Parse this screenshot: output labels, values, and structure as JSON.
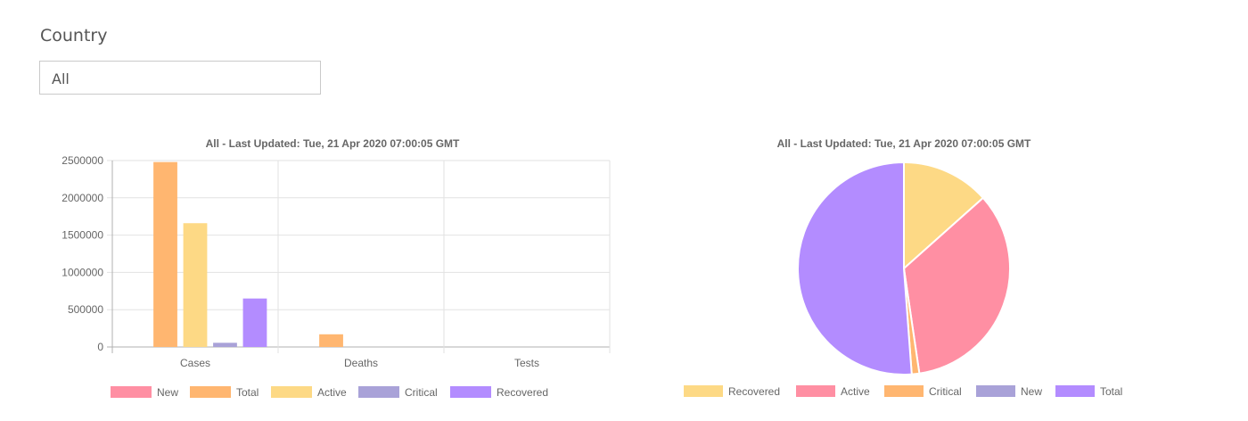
{
  "filter": {
    "label": "Country",
    "value": "All"
  },
  "chart_data": [
    {
      "type": "bar",
      "title": "All - Last Updated: Tue, 21 Apr 2020 07:00:05 GMT",
      "xlabel": "",
      "ylabel": "",
      "categories": [
        "Cases",
        "Deaths",
        "Tests"
      ],
      "ylim": [
        0,
        2500000
      ],
      "yticks": [
        0,
        500000,
        1000000,
        1500000,
        2000000,
        2500000
      ],
      "grid": true,
      "legend_position": "bottom",
      "series": [
        {
          "name": "New",
          "color": "#ff8fa3",
          "values": [
            0,
            0,
            0
          ]
        },
        {
          "name": "Total",
          "color": "#ffb670",
          "values": [
            2480000,
            170000,
            0
          ]
        },
        {
          "name": "Active",
          "color": "#fdd985",
          "values": [
            1660000,
            0,
            0
          ]
        },
        {
          "name": "Critical",
          "color": "#a9a2d8",
          "values": [
            56000,
            0,
            0
          ]
        },
        {
          "name": "Recovered",
          "color": "#b38cff",
          "values": [
            650000,
            0,
            0
          ]
        }
      ]
    },
    {
      "type": "pie",
      "title": "All - Last Updated: Tue, 21 Apr 2020 07:00:05 GMT",
      "legend_position": "bottom",
      "slices": [
        {
          "name": "Recovered",
          "color": "#fdd985",
          "value": 650000
        },
        {
          "name": "Active",
          "color": "#ff8fa3",
          "value": 1660000
        },
        {
          "name": "Critical",
          "color": "#ffb670",
          "value": 56000
        },
        {
          "name": "New",
          "color": "#a9a2d8",
          "value": 0
        },
        {
          "name": "Total",
          "color": "#b38cff",
          "value": 2480000
        }
      ]
    }
  ]
}
